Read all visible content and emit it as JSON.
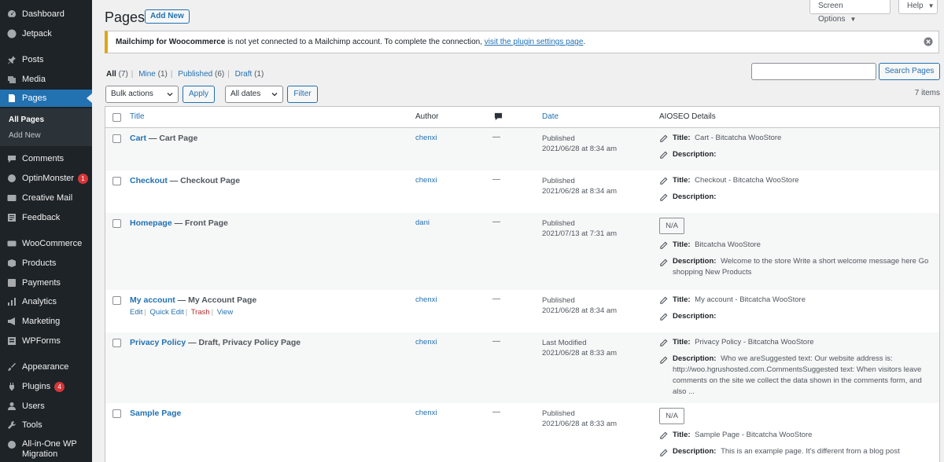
{
  "sidebar": {
    "items": [
      {
        "label": "Dashboard",
        "icon": "dashboard-icon"
      },
      {
        "label": "Jetpack",
        "icon": "jetpack-icon"
      },
      {
        "label": "Posts",
        "icon": "pin-icon"
      },
      {
        "label": "Media",
        "icon": "media-icon"
      },
      {
        "label": "Pages",
        "icon": "pages-icon"
      },
      {
        "label": "Comments",
        "icon": "comment-icon"
      },
      {
        "label": "OptinMonster",
        "icon": "optinmonster-icon",
        "badge": "1"
      },
      {
        "label": "Creative Mail",
        "icon": "cm-icon"
      },
      {
        "label": "Feedback",
        "icon": "feedback-icon"
      },
      {
        "label": "WooCommerce",
        "icon": "woo-icon"
      },
      {
        "label": "Products",
        "icon": "products-icon"
      },
      {
        "label": "Payments",
        "icon": "payments-icon"
      },
      {
        "label": "Analytics",
        "icon": "analytics-icon"
      },
      {
        "label": "Marketing",
        "icon": "megaphone-icon"
      },
      {
        "label": "WPForms",
        "icon": "wpforms-icon"
      },
      {
        "label": "Appearance",
        "icon": "brush-icon"
      },
      {
        "label": "Plugins",
        "icon": "plugin-icon",
        "badge": "4"
      },
      {
        "label": "Users",
        "icon": "users-icon"
      },
      {
        "label": "Tools",
        "icon": "wrench-icon"
      },
      {
        "label": "All-in-One WP Migration",
        "icon": "migration-icon"
      }
    ],
    "submenu": {
      "all_pages": "All Pages",
      "add_new": "Add New"
    }
  },
  "header": {
    "title": "Pages",
    "add_new": "Add New",
    "screen_options": "Screen Options",
    "help": "Help"
  },
  "notice": {
    "brand": "Mailchimp for Woocommerce",
    "text": " is not yet connected to a Mailchimp account. To complete the connection, ",
    "link": "visit the plugin settings page",
    "end": "."
  },
  "filters": {
    "all": "All",
    "all_count": "(7)",
    "mine": "Mine",
    "mine_count": "(1)",
    "published": "Published",
    "published_count": "(6)",
    "draft": "Draft",
    "draft_count": "(1)"
  },
  "search": {
    "button": "Search Pages",
    "value": ""
  },
  "toolbar": {
    "bulk_actions": "Bulk actions",
    "apply": "Apply",
    "all_dates": "All dates",
    "filter": "Filter",
    "items": "7 items"
  },
  "table": {
    "columns": {
      "title": "Title",
      "author": "Author",
      "date": "Date",
      "aioseo": "AIOSEO Details"
    },
    "rows": [
      {
        "title": "Cart",
        "state": " — Cart Page",
        "author": "chenxi",
        "comments": "—",
        "status": "Published",
        "date": "2021/06/28 at 8:34 am",
        "seo_title": "Cart - Bitcatcha WooStore",
        "seo_desc": ""
      },
      {
        "title": "Checkout",
        "state": " — Checkout Page",
        "author": "chenxi",
        "comments": "—",
        "status": "Published",
        "date": "2021/06/28 at 8:34 am",
        "seo_title": "Checkout - Bitcatcha WooStore",
        "seo_desc": ""
      },
      {
        "title": "Homepage",
        "state": " — Front Page",
        "author": "dani",
        "comments": "—",
        "status": "Published",
        "date": "2021/07/13 at 7:31 am",
        "na": "N/A",
        "seo_title": "Bitcatcha WooStore",
        "seo_desc": "Welcome to the store Write a short welcome message here Go shopping New Products"
      },
      {
        "title": "My account",
        "state": " — My Account Page",
        "author": "chenxi",
        "comments": "—",
        "status": "Published",
        "date": "2021/06/28 at 8:34 am",
        "seo_title": "My account - Bitcatcha WooStore",
        "seo_desc": "",
        "actions": {
          "edit": "Edit",
          "quick_edit": "Quick Edit",
          "trash": "Trash",
          "view": "View"
        }
      },
      {
        "title": "Privacy Policy",
        "state": " — Draft, Privacy Policy Page",
        "author": "chenxi",
        "comments": "—",
        "status": "Last Modified",
        "date": "2021/06/28 at 8:33 am",
        "seo_title": "Privacy Policy - Bitcatcha WooStore",
        "seo_desc": "Who we areSuggested text: Our website address is: http://woo.hgrushosted.com.CommentsSuggested text: When visitors leave comments on the site we collect the data shown in the comments form, and also ..."
      },
      {
        "title": "Sample Page",
        "state": "",
        "author": "chenxi",
        "comments": "—",
        "status": "Published",
        "date": "2021/06/28 at 8:33 am",
        "na": "N/A",
        "seo_title": "Sample Page - Bitcatcha WooStore",
        "seo_desc": "This is an example page. It's different from a blog post"
      }
    ],
    "labels": {
      "title": "Title:",
      "description": "Description:"
    }
  },
  "colors": {
    "accent": "#2271b1",
    "sidebar": "#1d2327",
    "notice_border": "#dba617",
    "badge": "#d63638"
  }
}
